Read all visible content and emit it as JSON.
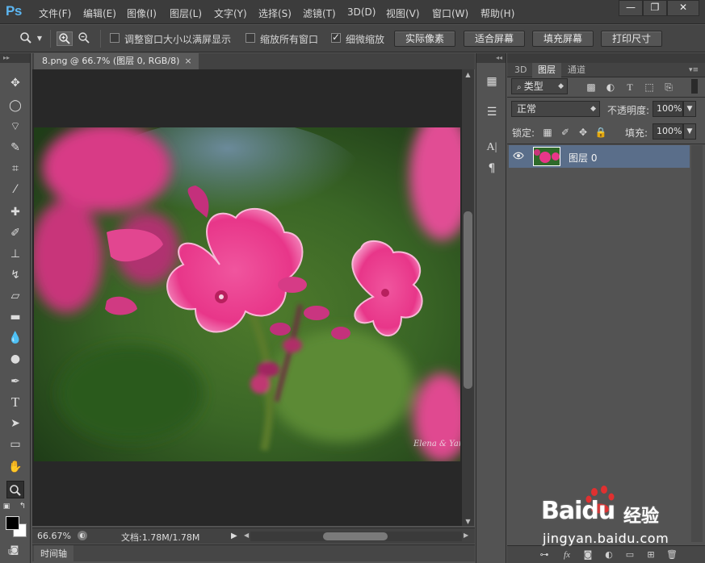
{
  "app": {
    "logo": "Ps"
  },
  "menu": [
    "文件(F)",
    "编辑(E)",
    "图像(I)",
    "图层(L)",
    "文字(Y)",
    "选择(S)",
    "滤镜(T)",
    "3D(D)",
    "视图(V)",
    "窗口(W)",
    "帮助(H)"
  ],
  "window_controls": {
    "minimize": "—",
    "restore": "❐",
    "close": "✕"
  },
  "options": {
    "resize_windows_label": "调整窗口大小以满屏显示",
    "resize_windows_checked": false,
    "zoom_all_label": "缩放所有窗口",
    "zoom_all_checked": false,
    "scrubby_label": "细微缩放",
    "scrubby_checked": true,
    "actual_pixels": "实际像素",
    "fit_screen": "适合屏幕",
    "fill_screen": "填充屏幕",
    "print_size": "打印尺寸"
  },
  "document": {
    "tab_title": "8.png @ 66.7% (图层 0, RGB/8)",
    "tab_close": "×",
    "zoom": "66.67%",
    "doc_info": "文档:1.78M/1.78M",
    "timeline": "时间轴"
  },
  "layers_panel": {
    "tabs": [
      "3D",
      "图层",
      "通道"
    ],
    "active_tab": "图层",
    "filter_kind": "类型",
    "blend_mode": "正常",
    "opacity_label": "不透明度:",
    "opacity_value": "100%",
    "lock_label": "锁定:",
    "fill_label": "填充:",
    "fill_value": "100%",
    "layer_name": "图层 0"
  },
  "watermark": {
    "brand": "Baidu",
    "product": "经验",
    "url": "jingyan.baidu.com"
  },
  "colors": {
    "accent": "#5cb6f1",
    "layer_selected": "#5a6e8a",
    "foreground": "#000000",
    "background": "#ffffff"
  }
}
